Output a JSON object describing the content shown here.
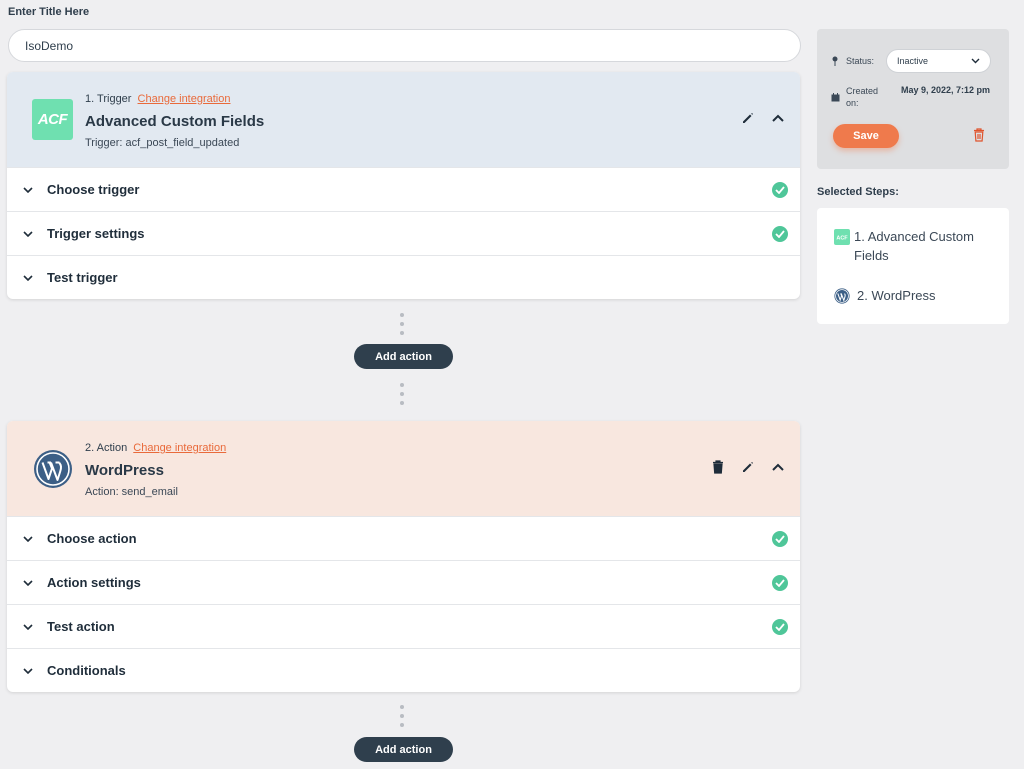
{
  "page": {
    "title_label": "Enter Title Here",
    "title_value": "IsoDemo"
  },
  "trigger": {
    "step_label": "1. Trigger",
    "change_link": "Change integration",
    "app_name": "Advanced Custom Fields",
    "detail": "Trigger: acf_post_field_updated",
    "logo_text": "ACF",
    "rows": [
      {
        "label": "Choose trigger",
        "complete": true
      },
      {
        "label": "Trigger settings",
        "complete": true
      },
      {
        "label": "Test trigger",
        "complete": false
      }
    ]
  },
  "add_action_label": "Add action",
  "action": {
    "step_label": "2. Action",
    "change_link": "Change integration",
    "app_name": "WordPress",
    "detail": "Action: send_email",
    "rows": [
      {
        "label": "Choose action",
        "complete": true
      },
      {
        "label": "Action settings",
        "complete": true
      },
      {
        "label": "Test action",
        "complete": true
      },
      {
        "label": "Conditionals",
        "complete": false
      }
    ]
  },
  "sidebar": {
    "status_label": "Status:",
    "status_value": "Inactive",
    "created_label": "Created on:",
    "created_value": "May 9, 2022, 7:12 pm",
    "save_label": "Save",
    "selected_steps_title": "Selected Steps:",
    "steps": [
      {
        "label": "1. Advanced Custom Fields",
        "icon": "acf-icon"
      },
      {
        "label": "2. WordPress",
        "icon": "wordpress-icon"
      }
    ]
  },
  "colors": {
    "accent": "#e96a3b",
    "save": "#ef7a4c",
    "check": "#4fc699",
    "trigger_header": "#e2e9f1",
    "action_header": "#f8e7df",
    "dark_button": "#2f3f4d"
  }
}
